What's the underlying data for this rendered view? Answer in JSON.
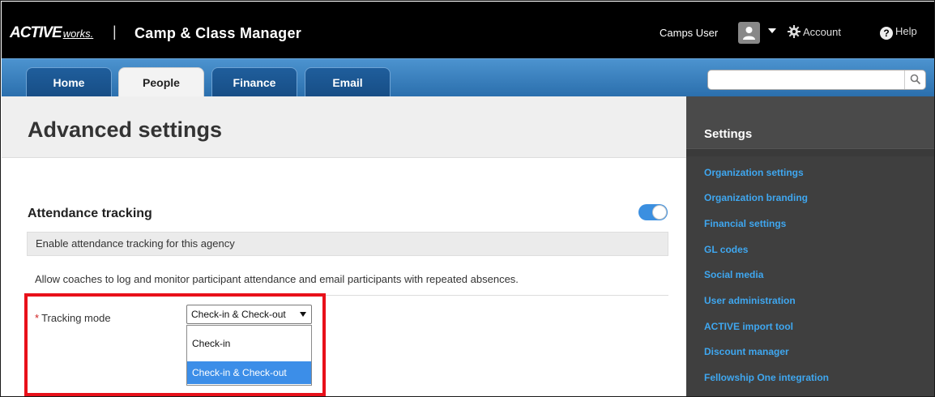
{
  "header": {
    "logo_text": "ACTIVE",
    "logo_sub": "works.",
    "separator": "|",
    "app_title": "Camp & Class Manager",
    "user_name": "Camps User",
    "account_label": "Account",
    "help_label": "Help",
    "help_icon_glyph": "?"
  },
  "nav": {
    "tabs": [
      {
        "label": "Home"
      },
      {
        "label": "People"
      },
      {
        "label": "Finance"
      },
      {
        "label": "Email"
      }
    ],
    "active_tab": "People",
    "search_placeholder": ""
  },
  "main": {
    "page_title": "Advanced settings",
    "section_title": "Attendance tracking",
    "toggle_on": true,
    "enable_text": "Enable attendance tracking for this agency",
    "description": "Allow coaches to log and monitor participant attendance and email participants with repeated absences.",
    "tracking_mode": {
      "required_mark": "*",
      "label": "Tracking mode",
      "selected": "Check-in & Check-out",
      "options": [
        "Check-in",
        "Check-in & Check-out"
      ]
    }
  },
  "sidebar": {
    "title": "Settings",
    "items": [
      {
        "label": "Organization settings"
      },
      {
        "label": "Organization branding"
      },
      {
        "label": "Financial settings"
      },
      {
        "label": "GL codes"
      },
      {
        "label": "Social media"
      },
      {
        "label": "User administration"
      },
      {
        "label": "ACTIVE import tool"
      },
      {
        "label": "Discount manager"
      },
      {
        "label": "Fellowship One integration"
      }
    ]
  },
  "colors": {
    "accent_blue": "#3b8fe0",
    "sidebar_link": "#3fa7f0",
    "highlight_red": "#e8101a"
  }
}
